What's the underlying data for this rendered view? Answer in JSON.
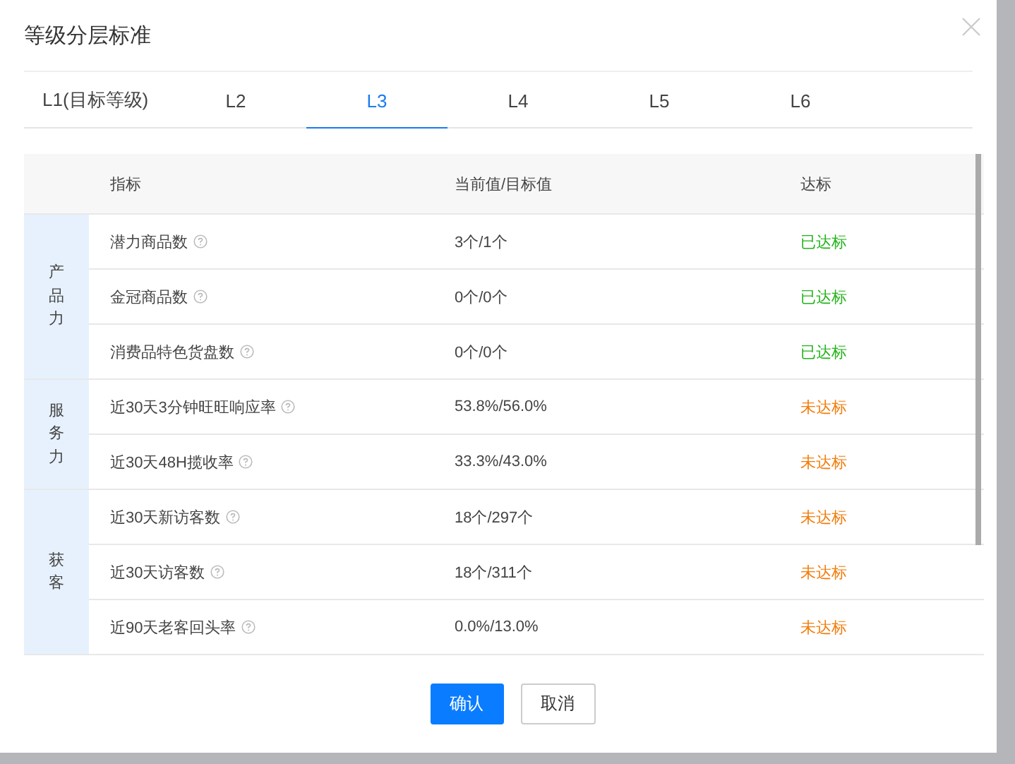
{
  "dialog": {
    "title": "等级分层标准"
  },
  "tabs": [
    {
      "label": "L1(目标等级)",
      "selected": false
    },
    {
      "label": "L2",
      "selected": false
    },
    {
      "label": "L3",
      "selected": true
    },
    {
      "label": "L4",
      "selected": false
    },
    {
      "label": "L5",
      "selected": false
    },
    {
      "label": "L6",
      "selected": false
    }
  ],
  "table": {
    "columns": [
      "指标",
      "当前值/目标值",
      "达标"
    ],
    "groups": [
      {
        "label": "产品力",
        "rows": [
          {
            "metric": "潜力商品数",
            "value": "3个/1个",
            "status": "已达标",
            "achieved": true
          },
          {
            "metric": "金冠商品数",
            "value": "0个/0个",
            "status": "已达标",
            "achieved": true
          },
          {
            "metric": "消费品特色货盘数",
            "value": "0个/0个",
            "status": "已达标",
            "achieved": true
          }
        ]
      },
      {
        "label": "服务力",
        "rows": [
          {
            "metric": "近30天3分钟旺旺响应率",
            "value": "53.8%/56.0%",
            "status": "未达标",
            "achieved": false
          },
          {
            "metric": "近30天48H揽收率",
            "value": "33.3%/43.0%",
            "status": "未达标",
            "achieved": false
          }
        ]
      },
      {
        "label": "获客",
        "rows": [
          {
            "metric": "近30天新访客数",
            "value": "18个/297个",
            "status": "未达标",
            "achieved": false
          },
          {
            "metric": "近30天访客数",
            "value": "18个/311个",
            "status": "未达标",
            "achieved": false
          },
          {
            "metric": "近90天老客回头率",
            "value": "0.0%/13.0%",
            "status": "未达标",
            "achieved": false
          }
        ]
      }
    ]
  },
  "buttons": [
    {
      "label": "确认",
      "kind": "primary"
    },
    {
      "label": "取消",
      "kind": "default"
    }
  ]
}
